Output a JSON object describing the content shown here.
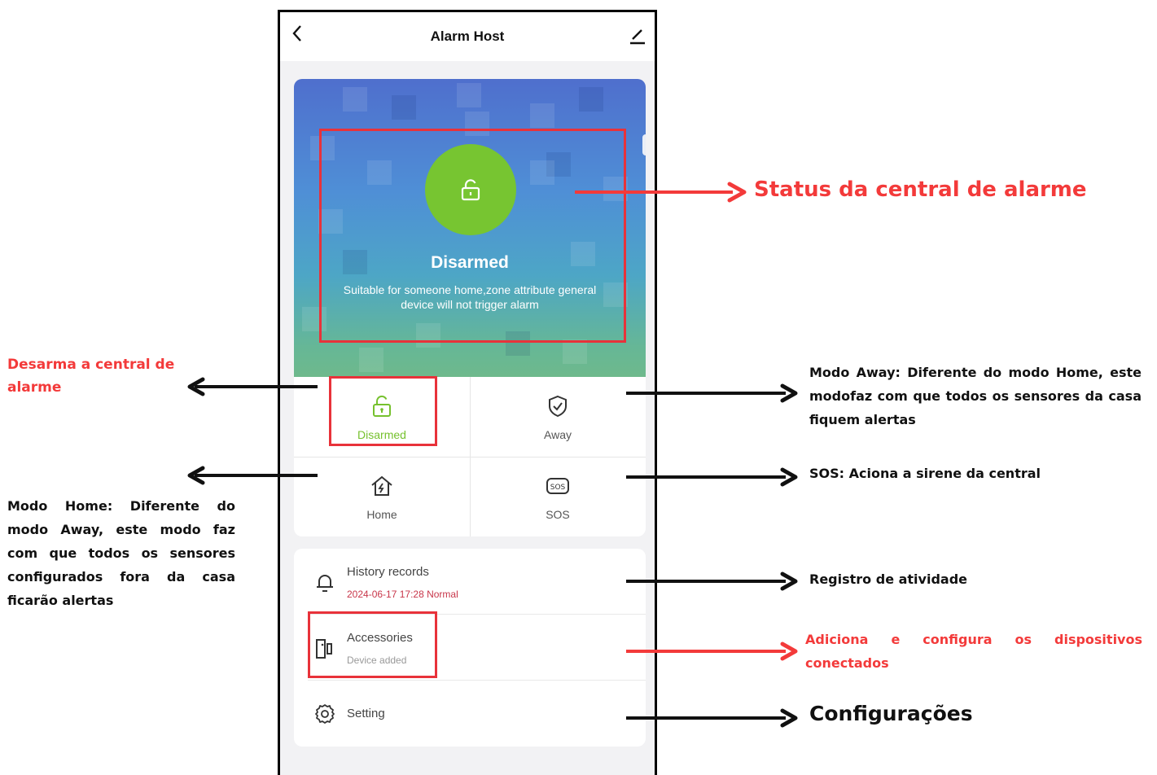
{
  "app": {
    "title": "Alarm Host",
    "back_icon": "chevron-left-icon",
    "edit_icon": "pencil-icon"
  },
  "hero": {
    "status": "Disarmed",
    "description": "Suitable for someone home,zone attribute general device will not trigger alarm",
    "circle_color": "#77c531",
    "icon": "unlocked-padlock-icon"
  },
  "modes": [
    {
      "label": "Disarmed",
      "icon": "unlocked-padlock-icon",
      "active": true
    },
    {
      "label": "Away",
      "icon": "shield-check-icon",
      "active": false
    },
    {
      "label": "Home",
      "icon": "house-bolt-icon",
      "active": false
    },
    {
      "label": "SOS",
      "icon": "sos-icon",
      "active": false
    }
  ],
  "list": {
    "history": {
      "title": "History records",
      "subtitle": "2024-06-17 17:28 Normal",
      "icon": "bell-icon"
    },
    "accessories": {
      "title": "Accessories",
      "subtitle": "Device added",
      "icon": "door-sensor-icon"
    },
    "setting": {
      "title": "Setting",
      "icon": "gear-icon"
    }
  },
  "annotations": {
    "status": "Status da central de alarme",
    "disarm": "Desarma a central de alarme",
    "home": "Modo Home: Diferente do modo Away, este modo faz com que todos os sensores configurados fora da casa ficarão alertas",
    "away": "Modo Away: Diferente do modo Home, este modofaz com que todos os sensores  da casa fiquem alertas",
    "sos": "SOS: Aciona a sirene da central",
    "history": "Registro de atividade",
    "accessories": "Adiciona e configura os dispositivos conectados",
    "setting": "Configurações"
  },
  "colors": {
    "annotation_red": "#f33a3a",
    "active_green": "#76c12e",
    "highlight_red": "#e8323a"
  }
}
